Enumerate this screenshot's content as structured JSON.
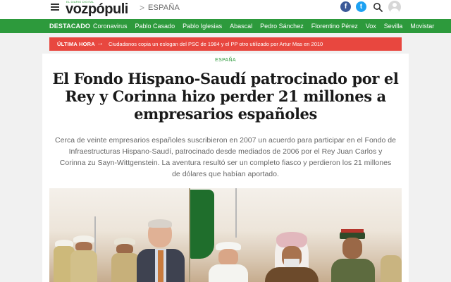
{
  "header": {
    "logo_tagline": "EL DIARIO DIGITAL",
    "logo": "vozpópuli",
    "breadcrumb_separator": ">",
    "breadcrumb": "ESPAÑA",
    "social": [
      {
        "name": "facebook",
        "glyph": "f"
      },
      {
        "name": "twitter",
        "glyph": "t"
      }
    ],
    "icons": [
      "menu-icon",
      "search-icon",
      "user-icon"
    ]
  },
  "nav": {
    "featured_label": "DESTACADO",
    "items": [
      "Coronavirus",
      "Pablo Casado",
      "Pablo Iglesias",
      "Abascal",
      "Pedro Sánchez",
      "Florentino Pérez",
      "Vox",
      "Sevilla",
      "Movistar"
    ]
  },
  "breaking": {
    "label": "ÚLTIMA HORA",
    "arrow": "→",
    "text": "Ciudadanos copia un eslogan del PSC de 1984 y el PP otro utilizado por Artur Mas en 2010"
  },
  "article": {
    "section": "ESPAÑA",
    "headline": "El Fondo Hispano-Saudí patrocinado por el Rey y Corinna hizo perder 21 millones a empresarios españoles",
    "lead": "Cerca de veinte empresarios españoles suscribieron en 2007 un acuerdo para participar en el Fondo de Infraestructuras Hispano-Saudí, patrocinado desde mediados de 2006 por el Rey Juan Carlos y Corinna zu Sayn-Wittgenstein. La aventura resultó ser un completo fiasco y perdieron los 21 millones de dólares que habían aportado."
  },
  "colors": {
    "brand_green": "#2d9a3c",
    "breaking_red": "#e8473f",
    "facebook": "#3b5998",
    "twitter": "#1da1f2"
  }
}
